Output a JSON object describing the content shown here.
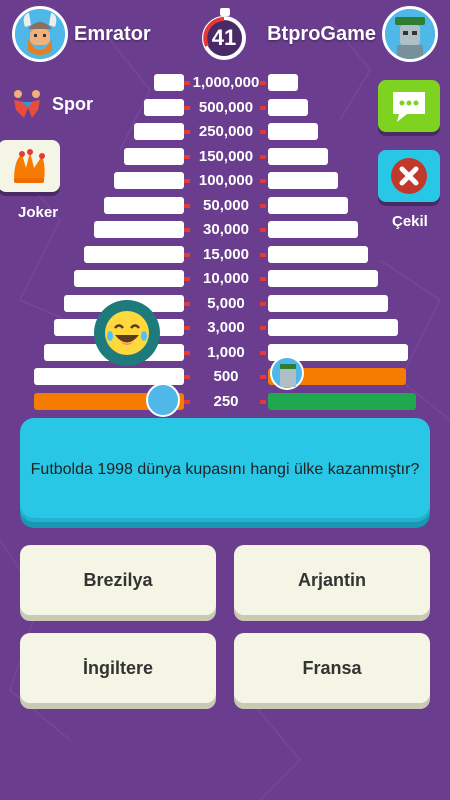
{
  "players": {
    "left": {
      "name": "Emrator"
    },
    "right": {
      "name": "BtproGame"
    }
  },
  "timer": {
    "value": "41"
  },
  "category": {
    "label": "Spor"
  },
  "side_buttons": {
    "joker_label": "Joker",
    "withdraw_label": "Çekil",
    "chat_icon": "chat-bubble-icon",
    "withdraw_icon": "x-icon",
    "joker_icon": "jester-hat-icon"
  },
  "ladder": {
    "amounts": [
      "1,000,000",
      "500,000",
      "250,000",
      "150,000",
      "100,000",
      "50,000",
      "30,000",
      "15,000",
      "10,000",
      "5,000",
      "3,000",
      "1,000",
      "500",
      "250"
    ],
    "left_player_level": "250",
    "right_player_level": "500"
  },
  "colors": {
    "background": "#6a3d8f",
    "question_bg": "#28c7e6",
    "orange": "#f57c00",
    "green": "#1fa84f",
    "tick": "#e53935"
  },
  "question": {
    "text": "Futbolda 1998 dünya kupasını hangi ülke kazanmıştır?"
  },
  "answers": [
    "Brezilya",
    "Arjantin",
    "İngiltere",
    "Fransa"
  ]
}
